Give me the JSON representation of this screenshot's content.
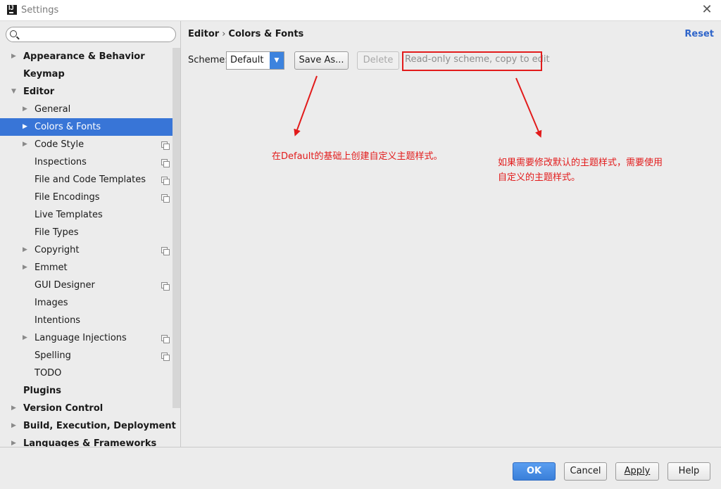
{
  "window": {
    "title": "Settings"
  },
  "search": {
    "placeholder": ""
  },
  "sidebar": {
    "items": [
      {
        "label": "Appearance & Behavior",
        "level": 0,
        "arrow": "right",
        "bold": true,
        "project": false,
        "selected": false
      },
      {
        "label": "Keymap",
        "level": 0,
        "arrow": "",
        "bold": true,
        "project": false,
        "selected": false
      },
      {
        "label": "Editor",
        "level": 0,
        "arrow": "down",
        "bold": true,
        "project": false,
        "selected": false
      },
      {
        "label": "General",
        "level": 1,
        "arrow": "right",
        "bold": false,
        "project": false,
        "selected": false
      },
      {
        "label": "Colors & Fonts",
        "level": 1,
        "arrow": "right",
        "bold": false,
        "project": false,
        "selected": true
      },
      {
        "label": "Code Style",
        "level": 1,
        "arrow": "right",
        "bold": false,
        "project": true,
        "selected": false
      },
      {
        "label": "Inspections",
        "level": 1,
        "arrow": "",
        "bold": false,
        "project": true,
        "selected": false
      },
      {
        "label": "File and Code Templates",
        "level": 1,
        "arrow": "",
        "bold": false,
        "project": true,
        "selected": false
      },
      {
        "label": "File Encodings",
        "level": 1,
        "arrow": "",
        "bold": false,
        "project": true,
        "selected": false
      },
      {
        "label": "Live Templates",
        "level": 1,
        "arrow": "",
        "bold": false,
        "project": false,
        "selected": false
      },
      {
        "label": "File Types",
        "level": 1,
        "arrow": "",
        "bold": false,
        "project": false,
        "selected": false
      },
      {
        "label": "Copyright",
        "level": 1,
        "arrow": "right",
        "bold": false,
        "project": true,
        "selected": false
      },
      {
        "label": "Emmet",
        "level": 1,
        "arrow": "right",
        "bold": false,
        "project": false,
        "selected": false
      },
      {
        "label": "GUI Designer",
        "level": 1,
        "arrow": "",
        "bold": false,
        "project": true,
        "selected": false
      },
      {
        "label": "Images",
        "level": 1,
        "arrow": "",
        "bold": false,
        "project": false,
        "selected": false
      },
      {
        "label": "Intentions",
        "level": 1,
        "arrow": "",
        "bold": false,
        "project": false,
        "selected": false
      },
      {
        "label": "Language Injections",
        "level": 1,
        "arrow": "right",
        "bold": false,
        "project": true,
        "selected": false
      },
      {
        "label": "Spelling",
        "level": 1,
        "arrow": "",
        "bold": false,
        "project": true,
        "selected": false
      },
      {
        "label": "TODO",
        "level": 1,
        "arrow": "",
        "bold": false,
        "project": false,
        "selected": false
      },
      {
        "label": "Plugins",
        "level": 0,
        "arrow": "",
        "bold": true,
        "project": false,
        "selected": false
      },
      {
        "label": "Version Control",
        "level": 0,
        "arrow": "right",
        "bold": true,
        "project": false,
        "selected": false
      },
      {
        "label": "Build, Execution, Deployment",
        "level": 0,
        "arrow": "right",
        "bold": true,
        "project": false,
        "selected": false
      },
      {
        "label": "Languages & Frameworks",
        "level": 0,
        "arrow": "right",
        "bold": true,
        "project": false,
        "selected": false
      }
    ]
  },
  "main": {
    "breadcrumb": {
      "parent": "Editor",
      "separator": "›",
      "current": "Colors & Fonts"
    },
    "reset_label": "Reset",
    "scheme": {
      "label": "Scheme:",
      "selected": "Default",
      "save_as_label": "Save As...",
      "delete_label": "Delete",
      "readonly_note": "Read-only scheme, copy to edit"
    },
    "annotations": {
      "left_note": "在Default的基础上创建自定义主题样式。",
      "right_note_line1": "如果需要修改默认的主题样式，需要使用",
      "right_note_line2": "自定义的主题样式。"
    }
  },
  "footer": {
    "ok_label": "OK",
    "cancel_label": "Cancel",
    "apply_label": "Apply",
    "help_label": "Help"
  },
  "colors": {
    "selection": "#3875d7",
    "link": "#2f65ca",
    "annotation_red": "#e21b1b",
    "primary_button": "#3a7fd9"
  }
}
